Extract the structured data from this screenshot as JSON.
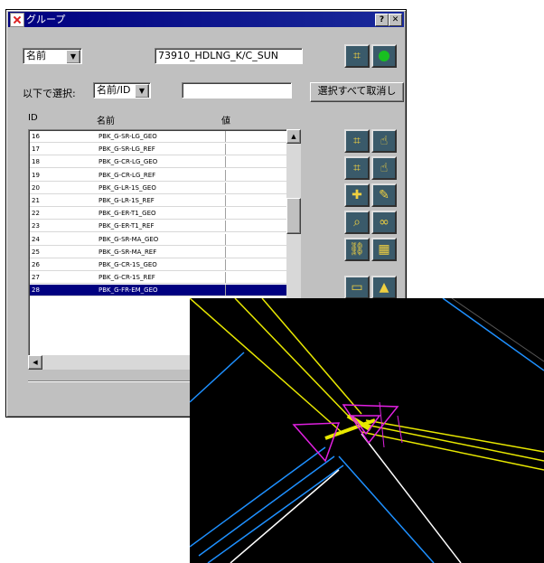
{
  "window": {
    "title": "グループ",
    "help_btn": "?",
    "close_btn": "✕"
  },
  "search_mode": {
    "value": "名前"
  },
  "group_name": {
    "value": "73910_HDLNG_K/C_SUN"
  },
  "filter": {
    "label": "以下で選択:",
    "mode_value": "名前/ID",
    "input_value": ""
  },
  "deselect_all_label": "選択すべて取消し",
  "columns": {
    "number": "ID",
    "name": "名前",
    "value": "値"
  },
  "rows": [
    {
      "n": "16",
      "name": "PBK_G-SR-LG_GEO"
    },
    {
      "n": "17",
      "name": "PBK_G-SR-LG_REF"
    },
    {
      "n": "18",
      "name": "PBK_G-CR-LG_GEO"
    },
    {
      "n": "19",
      "name": "PBK_G-CR-LG_REF"
    },
    {
      "n": "20",
      "name": "PBK_G-LR-1S_GEO"
    },
    {
      "n": "21",
      "name": "PBK_G-LR-1S_REF"
    },
    {
      "n": "22",
      "name": "PBK_G-ER-T1_GEO"
    },
    {
      "n": "23",
      "name": "PBK_G-ER-T1_REF"
    },
    {
      "n": "24",
      "name": "PBK_G-SR-MA_GEO"
    },
    {
      "n": "25",
      "name": "PBK_G-SR-MA_REF"
    },
    {
      "n": "26",
      "name": "PBK_G-CR-1S_GEO"
    },
    {
      "n": "27",
      "name": "PBK_G-CR-1S_REF"
    },
    {
      "n": "28",
      "name": "PBK_G-FR-EM_GEO"
    }
  ],
  "selected_row": "28",
  "icons": {
    "frame_select": "frame-select-icon",
    "active_indicator": "green-dot-icon"
  },
  "colors": {
    "title_bar": "#000080",
    "selection": "#000080",
    "tool_bg": "#3a5a6a",
    "cad_bg": "#000000",
    "line_yellow": "#e8e800",
    "line_cyan": "#1e90ff",
    "line_white": "#ffffff",
    "line_magenta": "#e020e0"
  }
}
